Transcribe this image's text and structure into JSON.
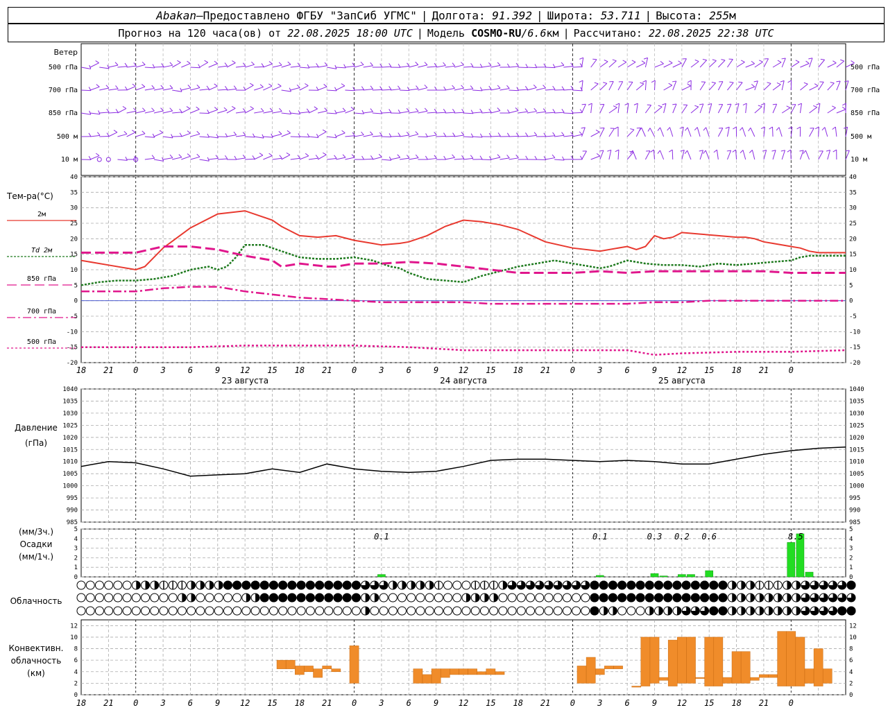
{
  "header": {
    "city": "Abakan",
    "dash": " — ",
    "provider": "Предоставлено ФГБУ \"ЗапСиб УГМС\"",
    "lon_label": "Долгота:",
    "lon_value": "91.392",
    "lat_label": "Широта:",
    "lat_value": "53.711",
    "alt_label": "Высота:",
    "alt_value": "255",
    "alt_unit": "м",
    "forecast_prefix": "Прогноз на 120 часа(ов) от",
    "forecast_time": "22.08.2025 18:00 UTC",
    "model_label": "Модель",
    "model_name": "COSMO-RU",
    "model_slash": " / ",
    "model_res": "6.6",
    "model_res_unit": "км",
    "calc_label": "Рассчитано:",
    "calc_time": "22.08.2025 22:38 UTC",
    "bar": "|"
  },
  "wind_panel": {
    "title": "Ветер",
    "levels": [
      "500 гПа",
      "700 гПа",
      "850 гПа",
      "500 м",
      "10  м"
    ],
    "color": "#8b2be2"
  },
  "temp_panel": {
    "title": "Тем-ра(°C)",
    "ylim": [
      -20,
      40
    ],
    "yticks": [
      40,
      35,
      30,
      25,
      20,
      15,
      10,
      5,
      0,
      -5,
      -10,
      -15,
      -20
    ],
    "legend": [
      {
        "label": "2м",
        "color": "#e8392f"
      },
      {
        "label": "Td  2м",
        "color": "#1e7a1e"
      },
      {
        "label": "850 гПа",
        "color": "#e0168c"
      },
      {
        "label": "700 гПа",
        "color": "#e0168c"
      },
      {
        "label": "500 гПа",
        "color": "#e0168c"
      }
    ],
    "zero_line_color": "#3344cc"
  },
  "time_axis": {
    "ticks": [
      "18",
      "21",
      "0",
      "3",
      "6",
      "9",
      "12",
      "15",
      "18",
      "21",
      "0",
      "3",
      "6",
      "9",
      "12",
      "15",
      "18",
      "21",
      "0",
      "3",
      "6",
      "9",
      "12",
      "15",
      "18",
      "21",
      "0"
    ],
    "day_labels": [
      "23 августа",
      "24 августа",
      "25 августа"
    ]
  },
  "pressure_panel": {
    "title": "Давление",
    "unit": "(гПа)",
    "ylim": [
      985,
      1040
    ],
    "yticks": [
      1040,
      1035,
      1030,
      1025,
      1020,
      1015,
      1010,
      1005,
      1000,
      995,
      990,
      985
    ]
  },
  "precip_panel": {
    "unit_top": "(мм/3ч.)",
    "title": "Осадки",
    "unit_bottom": "(мм/1ч.)",
    "ylim": [
      0,
      5
    ],
    "yticks": [
      5,
      4,
      3,
      2,
      1,
      0
    ],
    "color": "#22dd22",
    "annotations": [
      {
        "hour": 33,
        "text": "0.1"
      },
      {
        "hour": 57,
        "text": "0.1"
      },
      {
        "hour": 63,
        "text": "0.3"
      },
      {
        "hour": 66,
        "text": "0.2"
      },
      {
        "hour": 69,
        "text": "0.6"
      },
      {
        "hour": 78.5,
        "text": "8.5"
      }
    ]
  },
  "cloud_panel": {
    "title": "Облачность"
  },
  "conv_panel": {
    "title_1": "Конвективн.",
    "title_2": "облачность",
    "unit": "(км)",
    "ylim": [
      0,
      13
    ],
    "yticks": [
      12,
      10,
      8,
      6,
      4,
      2,
      0
    ],
    "color": "#f08c2a"
  },
  "chart_data": [
    {
      "type": "line",
      "title": "Тем-ра(°C)",
      "x_unit": "hours from 22.08.2025 18:00 UTC",
      "ylim": [
        -20,
        40
      ],
      "series": [
        {
          "name": "2м",
          "x": [
            0,
            3,
            6,
            7,
            9,
            12,
            15,
            18,
            21,
            22,
            24,
            26,
            28,
            30,
            32,
            33,
            35,
            36,
            38,
            40,
            42,
            44,
            46,
            48,
            51,
            54,
            57,
            60,
            61,
            62,
            63,
            64,
            65,
            66,
            68,
            70,
            72,
            73,
            74,
            75,
            76,
            78,
            79,
            80,
            81,
            82,
            84
          ],
          "y": [
            13,
            11.5,
            10,
            11,
            17,
            23.5,
            28,
            29,
            26,
            24,
            21,
            20.5,
            21,
            19.5,
            18.5,
            18,
            18.5,
            19,
            21,
            24,
            26,
            25.5,
            24.5,
            23,
            19,
            17,
            16,
            17.5,
            16.5,
            17.5,
            21,
            20,
            20.5,
            22,
            21.5,
            21,
            20.5,
            20.5,
            20,
            19,
            18.5,
            17.5,
            17,
            16,
            15.5,
            15.5,
            15.5
          ]
        },
        {
          "name": "Td  2м",
          "x": [
            0,
            2,
            4,
            6,
            8,
            10,
            12,
            14,
            15,
            16,
            17,
            18,
            20,
            22,
            24,
            26,
            28,
            30,
            32,
            33,
            34,
            35,
            36,
            38,
            40,
            42,
            44,
            46,
            48,
            50,
            52,
            54,
            56,
            57,
            58,
            59,
            60,
            62,
            64,
            66,
            68,
            70,
            72,
            74,
            76,
            78,
            79,
            80,
            82,
            84
          ],
          "y": [
            5,
            6,
            6.5,
            6.5,
            7,
            8,
            10,
            11,
            10,
            11,
            14,
            18,
            18,
            16,
            14,
            13.5,
            13.5,
            14,
            13,
            12,
            11,
            10.5,
            9,
            7,
            6.5,
            6,
            8,
            9.5,
            11,
            12,
            13,
            12,
            11,
            10.5,
            11,
            12,
            13,
            12,
            11.5,
            11.5,
            11,
            12,
            11.5,
            12,
            12.5,
            13,
            14,
            14.5,
            14.5,
            14.5
          ]
        },
        {
          "name": "850 гПа",
          "x": [
            0,
            3,
            6,
            9,
            12,
            15,
            18,
            21,
            22,
            24,
            27,
            28,
            30,
            33,
            36,
            39,
            42,
            45,
            48,
            51,
            54,
            57,
            60,
            63,
            66,
            69,
            72,
            75,
            78,
            81,
            84
          ],
          "y": [
            15.5,
            15.5,
            15.5,
            17.5,
            17.5,
            16.5,
            14.5,
            13,
            11,
            12,
            11,
            11,
            12,
            12,
            12.5,
            12,
            11,
            10,
            9,
            9,
            9,
            9.5,
            9,
            9.5,
            9.5,
            9.5,
            9.5,
            9.5,
            9,
            9,
            9
          ]
        },
        {
          "name": "700 гПа",
          "x": [
            0,
            3,
            6,
            9,
            12,
            15,
            18,
            21,
            24,
            27,
            30,
            33,
            36,
            39,
            42,
            45,
            48,
            51,
            54,
            57,
            60,
            63,
            66,
            69,
            72,
            75,
            78,
            81,
            84
          ],
          "y": [
            3,
            3,
            3,
            4,
            4.5,
            4.5,
            3,
            2,
            1,
            0.5,
            0,
            -0.5,
            -0.5,
            -0.5,
            -0.5,
            -1,
            -1,
            -1,
            -1,
            -1,
            -1,
            -0.5,
            -0.5,
            0,
            0,
            0,
            0,
            0,
            0
          ]
        },
        {
          "name": "500 гПа",
          "x": [
            0,
            6,
            12,
            18,
            24,
            30,
            36,
            42,
            48,
            54,
            57,
            60,
            62,
            63,
            66,
            72,
            78,
            84
          ],
          "y": [
            -15,
            -15,
            -15,
            -14.5,
            -14.5,
            -14.5,
            -15,
            -16,
            -16,
            -16,
            -16,
            -16,
            -17,
            -17.5,
            -17,
            -16.5,
            -16.5,
            -16
          ]
        }
      ]
    },
    {
      "type": "line",
      "title": "Давление",
      "x_unit": "hours from 22.08.2025 18:00 UTC",
      "ylim": [
        985,
        1040
      ],
      "series": [
        {
          "name": "",
          "x": [
            0,
            3,
            6,
            9,
            12,
            15,
            18,
            21,
            24,
            27,
            30,
            33,
            36,
            39,
            42,
            45,
            48,
            51,
            54,
            57,
            60,
            63,
            66,
            69,
            72,
            75,
            78,
            81,
            84
          ],
          "y": [
            1008,
            1010,
            1009.5,
            1007,
            1004,
            1004.5,
            1005,
            1007,
            1005.5,
            1009,
            1007,
            1006,
            1005.5,
            1006,
            1008,
            1010.5,
            1011,
            1011,
            1010.5,
            1010,
            1010.5,
            1010,
            1009,
            1009,
            1011,
            1013,
            1014.5,
            1015.5,
            1016
          ]
        }
      ]
    },
    {
      "type": "bar",
      "title": "Осадки",
      "x_unit": "hours from 22.08.2025 18:00 UTC",
      "ylim": [
        0,
        5
      ],
      "x": [
        33,
        57,
        63,
        64,
        66,
        67,
        69,
        78,
        79,
        80
      ],
      "values": [
        0.25,
        0.15,
        0.35,
        0.1,
        0.25,
        0.25,
        0.65,
        3.6,
        4.5,
        0.5
      ]
    },
    {
      "type": "bar",
      "title": "Облачность",
      "x_unit": "hours from 22.08.2025 18:00 UTC",
      "rows": [
        {
          "level": "top",
          "values": [
            0,
            0,
            0,
            0,
            0,
            0,
            2,
            2,
            2,
            1,
            1,
            1,
            2,
            2,
            2,
            2,
            4,
            4,
            4,
            4,
            4,
            4,
            4,
            4,
            4,
            4,
            4,
            4,
            4,
            4,
            4,
            3,
            3,
            3,
            2,
            2,
            2,
            2,
            2,
            1,
            0,
            0,
            0,
            1,
            1,
            1,
            2,
            3,
            3,
            3,
            3,
            3,
            3,
            3,
            3,
            3,
            4,
            4,
            4,
            4,
            4,
            4,
            4,
            4,
            4,
            4,
            4,
            4,
            4,
            4,
            4,
            2,
            2,
            2,
            1,
            1,
            1,
            2,
            2,
            3,
            3,
            3,
            3,
            3,
            4
          ]
        },
        {
          "level": "middle",
          "values": [
            0,
            0,
            0,
            0,
            0,
            0,
            0,
            0,
            0,
            0,
            0,
            2,
            2,
            0,
            0,
            0,
            0,
            0,
            2,
            2,
            4,
            4,
            4,
            4,
            4,
            4,
            4,
            4,
            4,
            4,
            4,
            2,
            2,
            0,
            0,
            0,
            0,
            0,
            0,
            0,
            0,
            0,
            2,
            2,
            2,
            2,
            0,
            0,
            0,
            0,
            0,
            0,
            0,
            0,
            0,
            0,
            4,
            4,
            4,
            4,
            4,
            4,
            4,
            4,
            4,
            4,
            4,
            4,
            4,
            4,
            4,
            2,
            2,
            2,
            2,
            2,
            2,
            2,
            2,
            3,
            3,
            3,
            3,
            3,
            3
          ]
        },
        {
          "level": "low",
          "values": [
            0,
            0,
            0,
            0,
            0,
            0,
            0,
            0,
            0,
            0,
            0,
            0,
            0,
            0,
            0,
            0,
            0,
            0,
            0,
            0,
            0,
            0,
            0,
            0,
            0,
            0,
            0,
            0,
            0,
            0,
            0,
            2,
            0,
            0,
            0,
            0,
            0,
            0,
            0,
            0,
            0,
            0,
            0,
            0,
            0,
            0,
            0,
            0,
            0,
            0,
            0,
            0,
            0,
            0,
            0,
            0,
            4,
            2,
            2,
            0,
            0,
            0,
            2,
            2,
            2,
            2,
            3,
            3,
            3,
            4,
            4,
            2,
            2,
            2,
            2,
            2,
            2,
            2,
            2,
            3,
            3,
            3,
            3,
            4,
            4
          ]
        }
      ]
    },
    {
      "type": "bar",
      "title": "Конвективн. облачность",
      "x_unit": "hours from 22.08.2025 18:00 UTC",
      "ylim": [
        0,
        13
      ],
      "bars": [
        {
          "x": 22,
          "bottom": 4.5,
          "top": 6.0
        },
        {
          "x": 23,
          "bottom": 4.5,
          "top": 6.0
        },
        {
          "x": 24,
          "bottom": 3.5,
          "top": 5.0
        },
        {
          "x": 25,
          "bottom": 4.0,
          "top": 5.0
        },
        {
          "x": 26,
          "bottom": 3.0,
          "top": 4.5
        },
        {
          "x": 27,
          "bottom": 4.5,
          "top": 5.0
        },
        {
          "x": 28,
          "bottom": 4.0,
          "top": 4.5
        },
        {
          "x": 30,
          "bottom": 2.0,
          "top": 8.5
        },
        {
          "x": 37,
          "bottom": 2.0,
          "top": 4.5
        },
        {
          "x": 38,
          "bottom": 2.0,
          "top": 3.5
        },
        {
          "x": 39,
          "bottom": 2.0,
          "top": 4.5
        },
        {
          "x": 40,
          "bottom": 3.0,
          "top": 4.5
        },
        {
          "x": 41,
          "bottom": 3.5,
          "top": 4.5
        },
        {
          "x": 42,
          "bottom": 3.5,
          "top": 4.5
        },
        {
          "x": 43,
          "bottom": 3.5,
          "top": 4.5
        },
        {
          "x": 44,
          "bottom": 3.5,
          "top": 4.0
        },
        {
          "x": 45,
          "bottom": 3.5,
          "top": 4.5
        },
        {
          "x": 46,
          "bottom": 3.5,
          "top": 4.0
        },
        {
          "x": 55,
          "bottom": 2.0,
          "top": 5.0
        },
        {
          "x": 56,
          "bottom": 2.0,
          "top": 6.5
        },
        {
          "x": 57,
          "bottom": 3.5,
          "top": 4.5
        },
        {
          "x": 58,
          "bottom": 4.5,
          "top": 5.0
        },
        {
          "x": 59,
          "bottom": 4.5,
          "top": 5.0
        },
        {
          "x": 61,
          "bottom": 1.5,
          "top": 1.5
        },
        {
          "x": 62,
          "bottom": 1.5,
          "top": 10.0
        },
        {
          "x": 63,
          "bottom": 2.0,
          "top": 10.0
        },
        {
          "x": 64,
          "bottom": 2.5,
          "top": 3.0
        },
        {
          "x": 65,
          "bottom": 1.5,
          "top": 9.5
        },
        {
          "x": 66,
          "bottom": 2.0,
          "top": 10.0
        },
        {
          "x": 67,
          "bottom": 2.0,
          "top": 10.0
        },
        {
          "x": 68,
          "bottom": 3.0,
          "top": 3.0
        },
        {
          "x": 69,
          "bottom": 1.5,
          "top": 10.0
        },
        {
          "x": 70,
          "bottom": 1.5,
          "top": 10.0
        },
        {
          "x": 71,
          "bottom": 2.0,
          "top": 3.0
        },
        {
          "x": 72,
          "bottom": 2.0,
          "top": 7.5
        },
        {
          "x": 73,
          "bottom": 2.0,
          "top": 7.5
        },
        {
          "x": 74,
          "bottom": 2.5,
          "top": 3.0
        },
        {
          "x": 75,
          "bottom": 3.0,
          "top": 3.5
        },
        {
          "x": 76,
          "bottom": 3.0,
          "top": 3.5
        },
        {
          "x": 77,
          "bottom": 1.5,
          "top": 11.0
        },
        {
          "x": 78,
          "bottom": 1.5,
          "top": 11.0
        },
        {
          "x": 79,
          "bottom": 1.5,
          "top": 10.0
        },
        {
          "x": 80,
          "bottom": 2.0,
          "top": 4.5
        },
        {
          "x": 81,
          "bottom": 1.5,
          "top": 8.0
        },
        {
          "x": 82,
          "bottom": 2.0,
          "top": 4.5
        }
      ]
    }
  ]
}
